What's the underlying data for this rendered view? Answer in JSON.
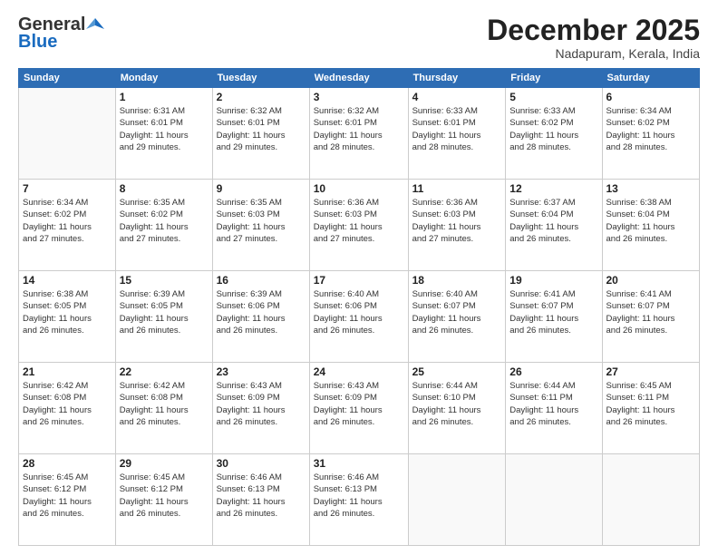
{
  "logo": {
    "general": "General",
    "blue": "Blue"
  },
  "header": {
    "month": "December 2025",
    "location": "Nadapuram, Kerala, India"
  },
  "weekdays": [
    "Sunday",
    "Monday",
    "Tuesday",
    "Wednesday",
    "Thursday",
    "Friday",
    "Saturday"
  ],
  "weeks": [
    [
      {
        "day": "",
        "info": ""
      },
      {
        "day": "1",
        "info": "Sunrise: 6:31 AM\nSunset: 6:01 PM\nDaylight: 11 hours\nand 29 minutes."
      },
      {
        "day": "2",
        "info": "Sunrise: 6:32 AM\nSunset: 6:01 PM\nDaylight: 11 hours\nand 29 minutes."
      },
      {
        "day": "3",
        "info": "Sunrise: 6:32 AM\nSunset: 6:01 PM\nDaylight: 11 hours\nand 28 minutes."
      },
      {
        "day": "4",
        "info": "Sunrise: 6:33 AM\nSunset: 6:01 PM\nDaylight: 11 hours\nand 28 minutes."
      },
      {
        "day": "5",
        "info": "Sunrise: 6:33 AM\nSunset: 6:02 PM\nDaylight: 11 hours\nand 28 minutes."
      },
      {
        "day": "6",
        "info": "Sunrise: 6:34 AM\nSunset: 6:02 PM\nDaylight: 11 hours\nand 28 minutes."
      }
    ],
    [
      {
        "day": "7",
        "info": "Sunrise: 6:34 AM\nSunset: 6:02 PM\nDaylight: 11 hours\nand 27 minutes."
      },
      {
        "day": "8",
        "info": "Sunrise: 6:35 AM\nSunset: 6:02 PM\nDaylight: 11 hours\nand 27 minutes."
      },
      {
        "day": "9",
        "info": "Sunrise: 6:35 AM\nSunset: 6:03 PM\nDaylight: 11 hours\nand 27 minutes."
      },
      {
        "day": "10",
        "info": "Sunrise: 6:36 AM\nSunset: 6:03 PM\nDaylight: 11 hours\nand 27 minutes."
      },
      {
        "day": "11",
        "info": "Sunrise: 6:36 AM\nSunset: 6:03 PM\nDaylight: 11 hours\nand 27 minutes."
      },
      {
        "day": "12",
        "info": "Sunrise: 6:37 AM\nSunset: 6:04 PM\nDaylight: 11 hours\nand 26 minutes."
      },
      {
        "day": "13",
        "info": "Sunrise: 6:38 AM\nSunset: 6:04 PM\nDaylight: 11 hours\nand 26 minutes."
      }
    ],
    [
      {
        "day": "14",
        "info": "Sunrise: 6:38 AM\nSunset: 6:05 PM\nDaylight: 11 hours\nand 26 minutes."
      },
      {
        "day": "15",
        "info": "Sunrise: 6:39 AM\nSunset: 6:05 PM\nDaylight: 11 hours\nand 26 minutes."
      },
      {
        "day": "16",
        "info": "Sunrise: 6:39 AM\nSunset: 6:06 PM\nDaylight: 11 hours\nand 26 minutes."
      },
      {
        "day": "17",
        "info": "Sunrise: 6:40 AM\nSunset: 6:06 PM\nDaylight: 11 hours\nand 26 minutes."
      },
      {
        "day": "18",
        "info": "Sunrise: 6:40 AM\nSunset: 6:07 PM\nDaylight: 11 hours\nand 26 minutes."
      },
      {
        "day": "19",
        "info": "Sunrise: 6:41 AM\nSunset: 6:07 PM\nDaylight: 11 hours\nand 26 minutes."
      },
      {
        "day": "20",
        "info": "Sunrise: 6:41 AM\nSunset: 6:07 PM\nDaylight: 11 hours\nand 26 minutes."
      }
    ],
    [
      {
        "day": "21",
        "info": "Sunrise: 6:42 AM\nSunset: 6:08 PM\nDaylight: 11 hours\nand 26 minutes."
      },
      {
        "day": "22",
        "info": "Sunrise: 6:42 AM\nSunset: 6:08 PM\nDaylight: 11 hours\nand 26 minutes."
      },
      {
        "day": "23",
        "info": "Sunrise: 6:43 AM\nSunset: 6:09 PM\nDaylight: 11 hours\nand 26 minutes."
      },
      {
        "day": "24",
        "info": "Sunrise: 6:43 AM\nSunset: 6:09 PM\nDaylight: 11 hours\nand 26 minutes."
      },
      {
        "day": "25",
        "info": "Sunrise: 6:44 AM\nSunset: 6:10 PM\nDaylight: 11 hours\nand 26 minutes."
      },
      {
        "day": "26",
        "info": "Sunrise: 6:44 AM\nSunset: 6:11 PM\nDaylight: 11 hours\nand 26 minutes."
      },
      {
        "day": "27",
        "info": "Sunrise: 6:45 AM\nSunset: 6:11 PM\nDaylight: 11 hours\nand 26 minutes."
      }
    ],
    [
      {
        "day": "28",
        "info": "Sunrise: 6:45 AM\nSunset: 6:12 PM\nDaylight: 11 hours\nand 26 minutes."
      },
      {
        "day": "29",
        "info": "Sunrise: 6:45 AM\nSunset: 6:12 PM\nDaylight: 11 hours\nand 26 minutes."
      },
      {
        "day": "30",
        "info": "Sunrise: 6:46 AM\nSunset: 6:13 PM\nDaylight: 11 hours\nand 26 minutes."
      },
      {
        "day": "31",
        "info": "Sunrise: 6:46 AM\nSunset: 6:13 PM\nDaylight: 11 hours\nand 26 minutes."
      },
      {
        "day": "",
        "info": ""
      },
      {
        "day": "",
        "info": ""
      },
      {
        "day": "",
        "info": ""
      }
    ]
  ]
}
